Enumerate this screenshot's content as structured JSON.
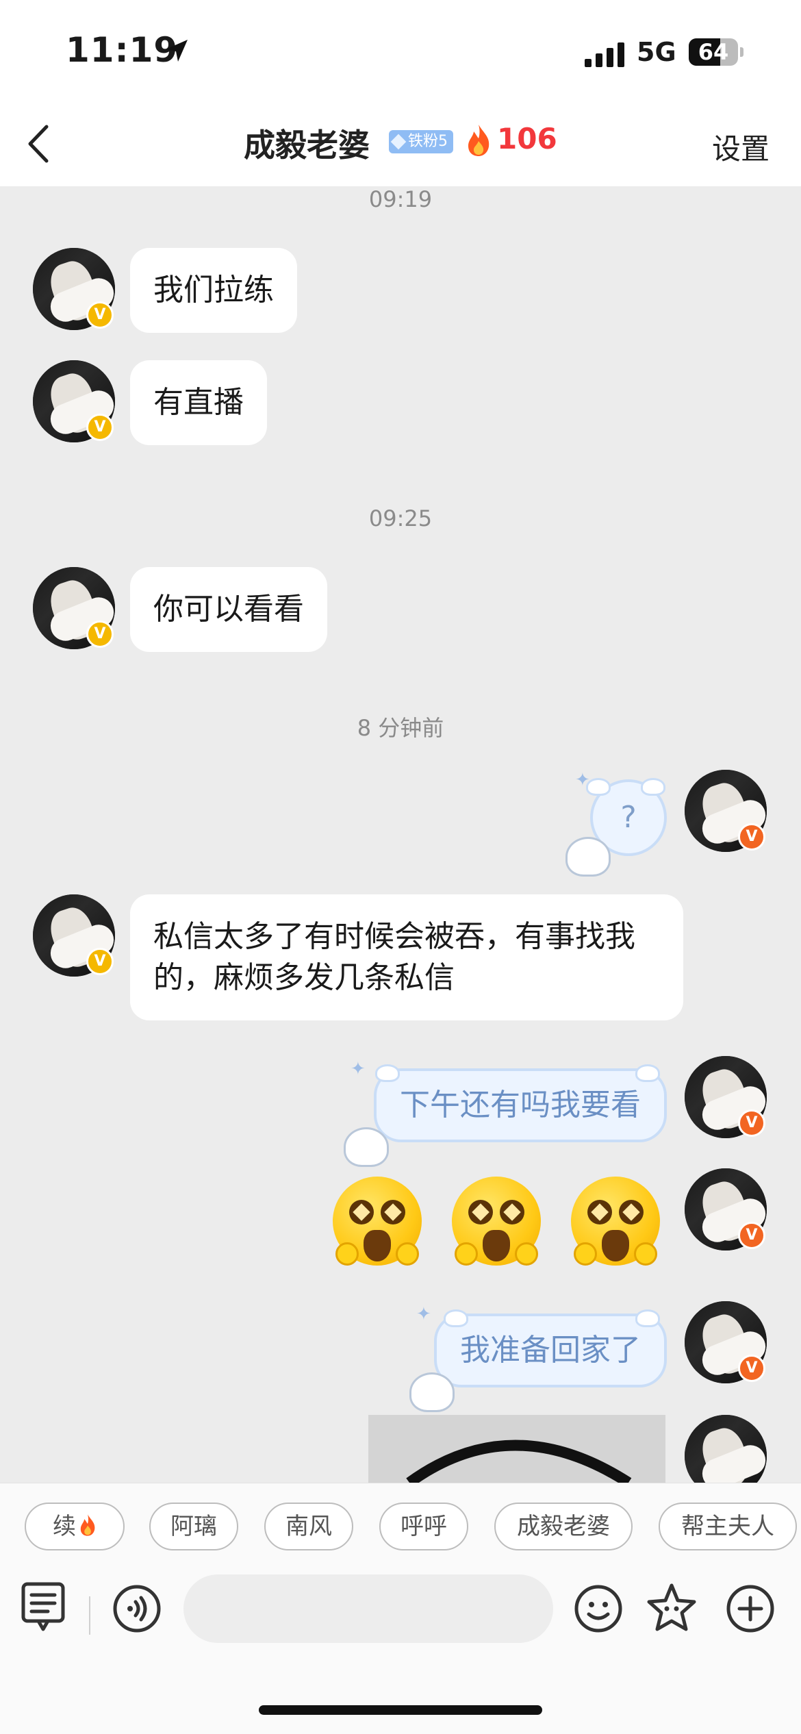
{
  "status_bar": {
    "time": "11:19",
    "network": "5G",
    "battery": "64",
    "battery_level": 0.64
  },
  "nav": {
    "title": "成毅老婆",
    "fan_badge": "铁粉5",
    "streak_count": "106",
    "settings_label": "设置"
  },
  "colors": {
    "streak_red": "#f2383c",
    "bubble_out_text": "#6a8fc4",
    "gold_badge": "#f5b800",
    "orange_badge": "#f26522"
  },
  "messages": {
    "ts1": "09:19",
    "m1": "我们拉练",
    "m2": "有直播",
    "ts2": "09:25",
    "m3": "你可以看看",
    "ts3": "8 分钟前",
    "m4_sticker": "?",
    "m5": "私信太多了有时候会被吞，有事找我的，麻烦多发几条私信",
    "m6": "下午还有吗我要看",
    "m8": "我准备回家了"
  },
  "avatar_badge": "V",
  "quick_replies": [
    "续",
    "阿璃",
    "南风",
    "呼呼",
    "成毅老婆",
    "帮主夫人"
  ],
  "input": {
    "placeholder": ""
  },
  "icons": {
    "back": "chevron-left-icon",
    "location": "location-arrow-icon",
    "fire": "flame-icon",
    "menu": "keyboard-menu-icon",
    "voice": "voice-icon",
    "emoji": "emoji-icon",
    "sticker": "star-sticker-icon",
    "plus": "plus-icon"
  }
}
